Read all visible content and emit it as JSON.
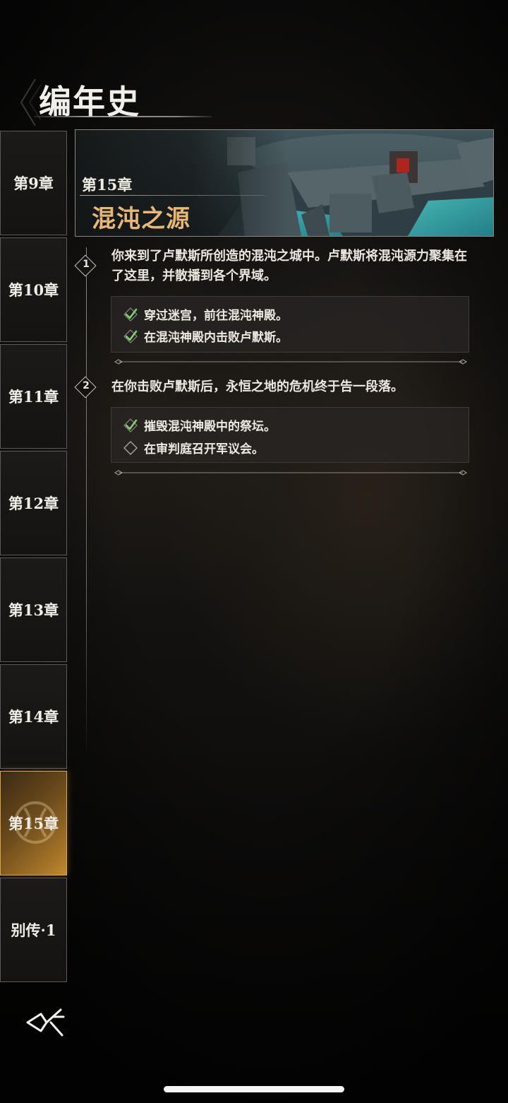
{
  "page_title": "编年史",
  "sidebar": {
    "tabs": [
      {
        "label": "第9章"
      },
      {
        "label": "第10章"
      },
      {
        "label": "第11章"
      },
      {
        "label": "第12章"
      },
      {
        "label": "第13章"
      },
      {
        "label": "第14章"
      },
      {
        "label": "第15章",
        "active": true
      },
      {
        "label": "别传·1"
      }
    ]
  },
  "chapter": {
    "number": "第15章",
    "name": "混沌之源"
  },
  "steps": [
    {
      "index": "1",
      "description": "你来到了卢默斯所创造的混沌之城中。卢默斯将混沌源力聚集在了这里，并散播到各个界域。",
      "tasks": [
        {
          "text": "穿过迷宫，前往混沌神殿。",
          "status": "check-icon"
        },
        {
          "text": "在混沌神殿内击败卢默斯。",
          "status": "check-icon"
        }
      ]
    },
    {
      "index": "2",
      "description": "在你击败卢默斯后，永恒之地的危机终于告一段落。",
      "tasks": [
        {
          "text": "摧毁混沌神殿中的祭坛。",
          "status": "check-icon"
        },
        {
          "text": "在审判庭召开军议会。",
          "status": "diamond-outline-icon"
        }
      ]
    }
  ],
  "colors": {
    "accent_gold": "#e6b779",
    "active_tab": "#a77628",
    "check_green": "#7fd36b"
  },
  "icons": {
    "back": "back-arrow-icon"
  }
}
